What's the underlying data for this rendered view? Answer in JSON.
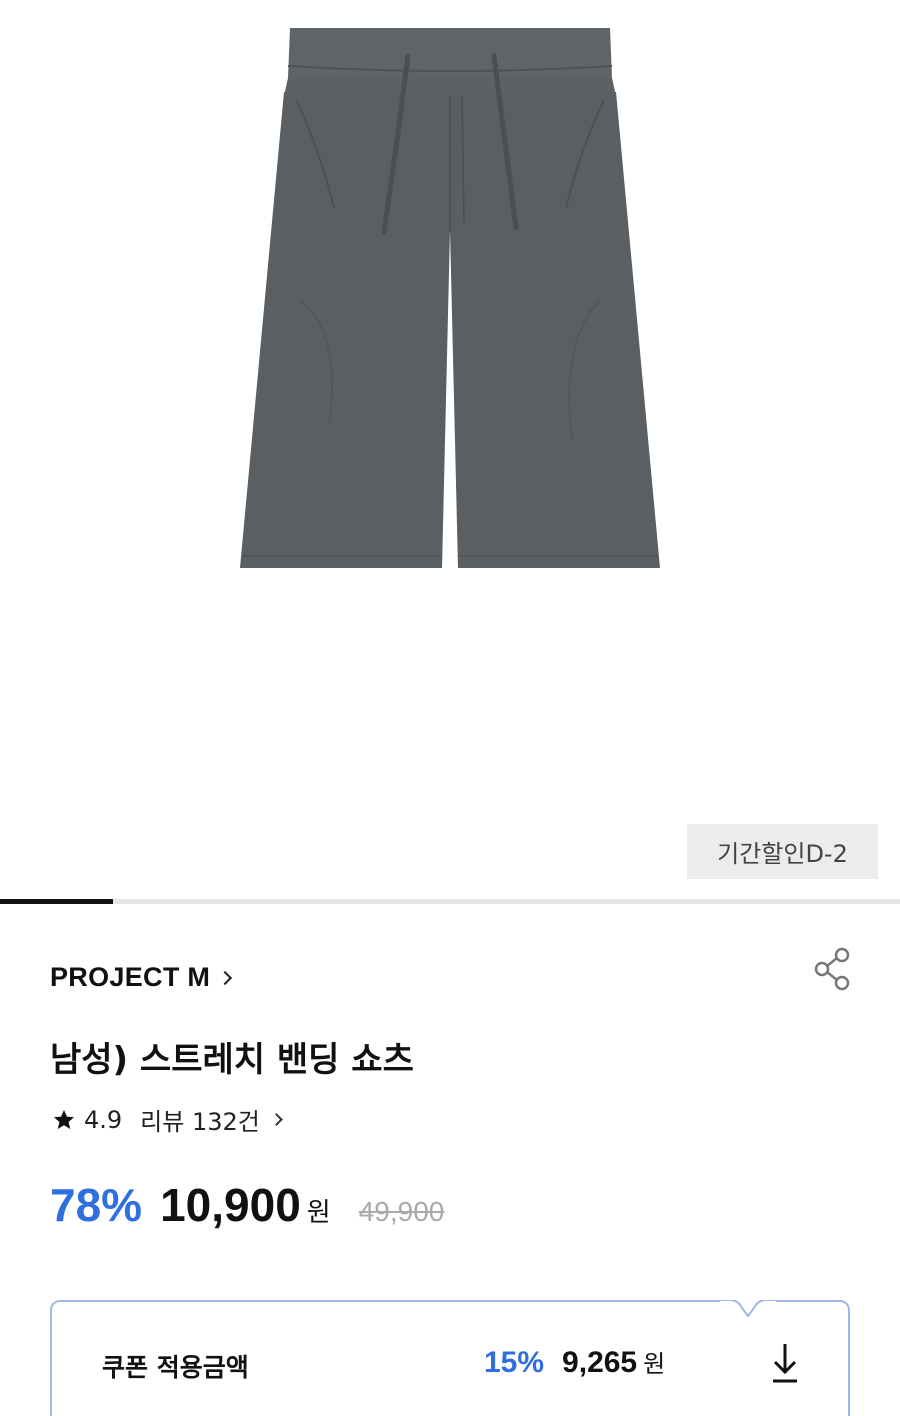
{
  "product": {
    "period_badge": "기간할인D-2",
    "image_progress": 0.125,
    "brand": "PROJECT M",
    "title": "남성) 스트레치 밴딩 쇼츠",
    "rating": "4.9",
    "review_label": "리뷰 132건",
    "discount_rate": "78%",
    "sale_price": "10,900",
    "currency": "원",
    "original_price": "49,900"
  },
  "coupon": {
    "label": "쿠폰 적용금액",
    "rate": "15%",
    "price": "9,265",
    "currency": "원"
  },
  "colors": {
    "accent": "#2f6fe0",
    "coupon_border": "#9fb6e6",
    "shorts": "#5a5f63"
  },
  "icons": [
    "share-icon",
    "star-icon",
    "chevron-right-icon",
    "download-icon"
  ]
}
